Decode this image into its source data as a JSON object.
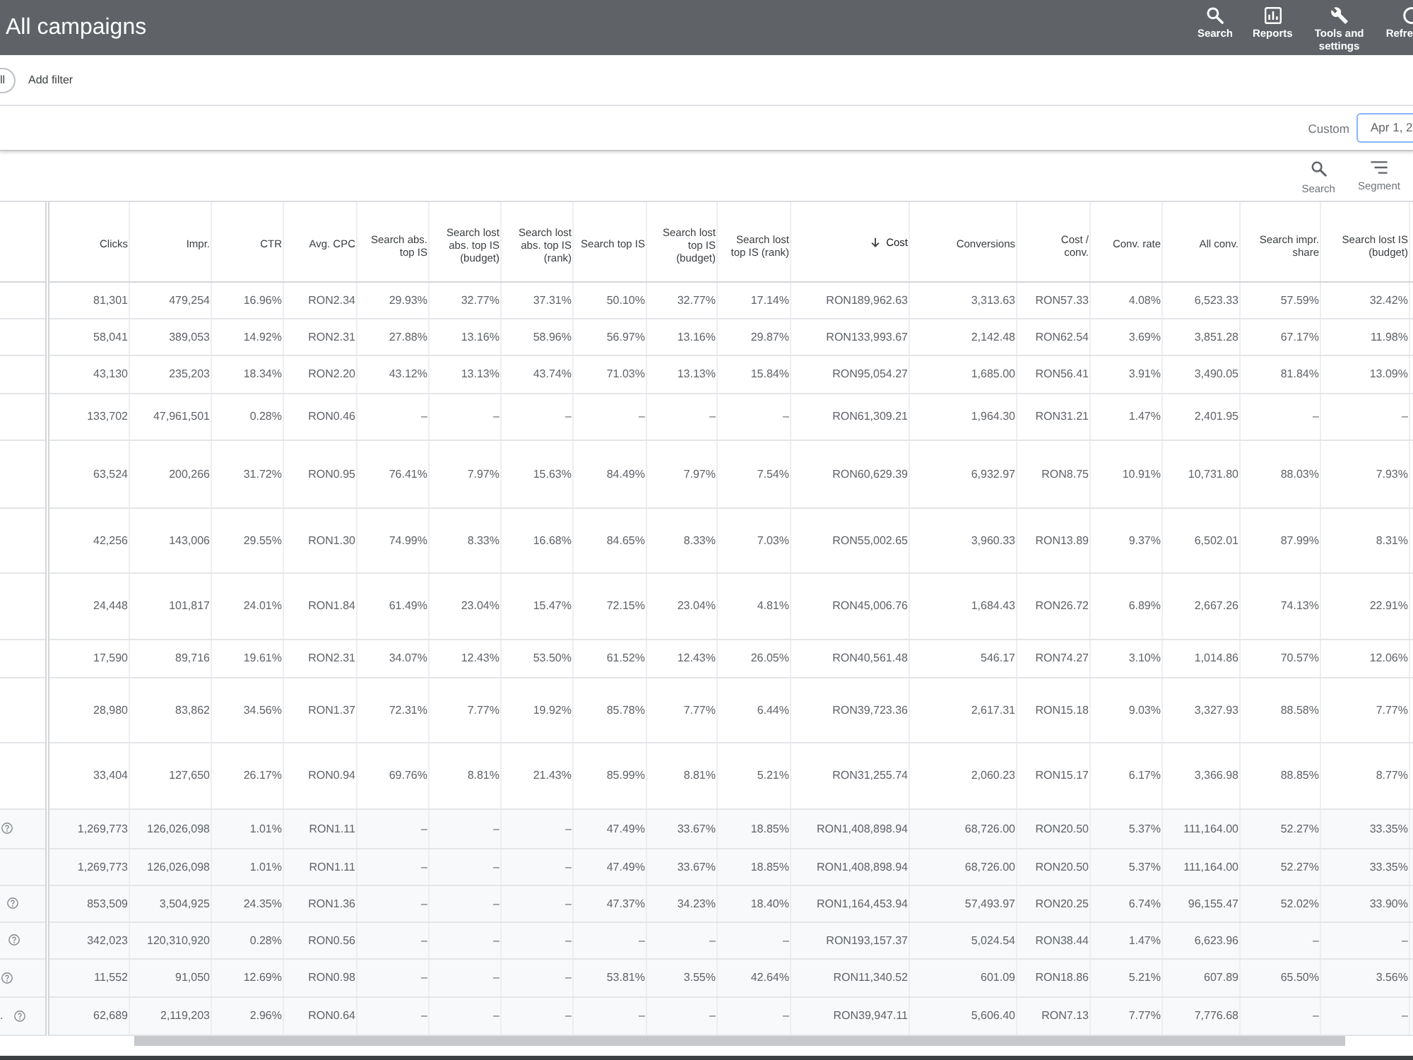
{
  "top_bar": {
    "title": "All campaigns",
    "actions": [
      {
        "kind": "search",
        "label": "Search"
      },
      {
        "kind": "reports",
        "label": "Reports"
      },
      {
        "kind": "tools",
        "label": "Tools and settings"
      },
      {
        "kind": "refresh",
        "label": "Refre"
      }
    ]
  },
  "filter_bar": {
    "chip": "ll",
    "add_filter": "Add filter"
  },
  "date_bar": {
    "range_label": "Custom",
    "date_field": {
      "value": "Apr 1, 2"
    }
  },
  "toolbar": [
    {
      "kind": "search",
      "label": "Search"
    },
    {
      "kind": "segment",
      "label": "Segment"
    }
  ],
  "table": {
    "columns": [
      {
        "label": "Clicks",
        "sorted": false
      },
      {
        "label": "Impr.",
        "sorted": false
      },
      {
        "label": "CTR",
        "sorted": false
      },
      {
        "label": "Avg. CPC",
        "sorted": false
      },
      {
        "label": "Search abs. top IS",
        "sorted": false
      },
      {
        "label": "Search lost abs. top IS (budget)",
        "sorted": false
      },
      {
        "label": "Search lost abs. top IS (rank)",
        "sorted": false
      },
      {
        "label": "Search top IS",
        "sorted": false
      },
      {
        "label": "Search lost top IS (budget)",
        "sorted": false
      },
      {
        "label": "Search lost top IS (rank)",
        "sorted": false
      },
      {
        "label": "Cost",
        "sorted": true
      },
      {
        "label": "Conversions",
        "sorted": false
      },
      {
        "label": "Cost / conv.",
        "sorted": false
      },
      {
        "label": "Conv. rate",
        "sorted": false
      },
      {
        "label": "All conv.",
        "sorted": false
      },
      {
        "label": "Search impr. share",
        "sorted": false
      },
      {
        "label": "Search lost IS (budget)",
        "sorted": false
      }
    ],
    "rows": [
      {
        "cells": [
          "81,301",
          "479,254",
          "16.96%",
          "RON2.34",
          "29.93%",
          "32.77%",
          "37.31%",
          "50.10%",
          "32.77%",
          "17.14%",
          "RON189,962.63",
          "3,313.63",
          "RON57.33",
          "4.08%",
          "6,523.33",
          "57.59%",
          "32.42%"
        ]
      },
      {
        "cells": [
          "58,041",
          "389,053",
          "14.92%",
          "RON2.31",
          "27.88%",
          "13.16%",
          "58.96%",
          "56.97%",
          "13.16%",
          "29.87%",
          "RON133,993.67",
          "2,142.48",
          "RON62.54",
          "3.69%",
          "3,851.28",
          "67.17%",
          "11.98%"
        ]
      },
      {
        "cells": [
          "43,130",
          "235,203",
          "18.34%",
          "RON2.20",
          "43.12%",
          "13.13%",
          "43.74%",
          "71.03%",
          "13.13%",
          "15.84%",
          "RON95,054.27",
          "1,685.00",
          "RON56.41",
          "3.91%",
          "3,490.05",
          "81.84%",
          "13.09%"
        ]
      },
      {
        "cells": [
          "133,702",
          "47,961,501",
          "0.28%",
          "RON0.46",
          "–",
          "–",
          "–",
          "–",
          "–",
          "–",
          "RON61,309.21",
          "1,964.30",
          "RON31.21",
          "1.47%",
          "2,401.95",
          "–",
          "–"
        ]
      },
      {
        "cells": [
          "63,524",
          "200,266",
          "31.72%",
          "RON0.95",
          "76.41%",
          "7.97%",
          "15.63%",
          "84.49%",
          "7.97%",
          "7.54%",
          "RON60,629.39",
          "6,932.97",
          "RON8.75",
          "10.91%",
          "10,731.80",
          "88.03%",
          "7.93%"
        ]
      },
      {
        "cells": [
          "42,256",
          "143,006",
          "29.55%",
          "RON1.30",
          "74.99%",
          "8.33%",
          "16.68%",
          "84.65%",
          "8.33%",
          "7.03%",
          "RON55,002.65",
          "3,960.33",
          "RON13.89",
          "9.37%",
          "6,502.01",
          "87.99%",
          "8.31%"
        ]
      },
      {
        "cells": [
          "24,448",
          "101,817",
          "24.01%",
          "RON1.84",
          "61.49%",
          "23.04%",
          "15.47%",
          "72.15%",
          "23.04%",
          "4.81%",
          "RON45,006.76",
          "1,684.43",
          "RON26.72",
          "6.89%",
          "2,667.26",
          "74.13%",
          "22.91%"
        ]
      },
      {
        "cells": [
          "17,590",
          "89,716",
          "19.61%",
          "RON2.31",
          "34.07%",
          "12.43%",
          "53.50%",
          "61.52%",
          "12.43%",
          "26.05%",
          "RON40,561.48",
          "546.17",
          "RON74.27",
          "3.10%",
          "1,014.86",
          "70.57%",
          "12.06%"
        ]
      },
      {
        "cells": [
          "28,980",
          "83,862",
          "34.56%",
          "RON1.37",
          "72.31%",
          "7.77%",
          "19.92%",
          "85.78%",
          "7.77%",
          "6.44%",
          "RON39,723.36",
          "2,617.31",
          "RON15.18",
          "9.03%",
          "3,327.93",
          "88.58%",
          "7.77%"
        ]
      },
      {
        "cells": [
          "33,404",
          "127,650",
          "26.17%",
          "RON0.94",
          "69.76%",
          "8.81%",
          "21.43%",
          "85.99%",
          "8.81%",
          "5.21%",
          "RON31,255.74",
          "2,060.23",
          "RON15.17",
          "6.17%",
          "3,366.98",
          "88.85%",
          "8.77%"
        ]
      }
    ],
    "summary_rows": [
      {
        "help": true,
        "cells": [
          "1,269,773",
          "126,026,098",
          "1.01%",
          "RON1.11",
          "–",
          "–",
          "–",
          "47.49%",
          "33.67%",
          "18.85%",
          "RON1,408,898.94",
          "68,726.00",
          "RON20.50",
          "5.37%",
          "111,164.00",
          "52.27%",
          "33.35%"
        ]
      },
      {
        "help": false,
        "cells": [
          "1,269,773",
          "126,026,098",
          "1.01%",
          "RON1.11",
          "–",
          "–",
          "–",
          "47.49%",
          "33.67%",
          "18.85%",
          "RON1,408,898.94",
          "68,726.00",
          "RON20.50",
          "5.37%",
          "111,164.00",
          "52.27%",
          "33.35%"
        ]
      },
      {
        "help": true,
        "cells": [
          "853,509",
          "3,504,925",
          "24.35%",
          "RON1.36",
          "–",
          "–",
          "–",
          "47.37%",
          "34.23%",
          "18.40%",
          "RON1,164,453.94",
          "57,493.97",
          "RON20.25",
          "6.74%",
          "96,155.47",
          "52.02%",
          "33.90%"
        ]
      },
      {
        "help": true,
        "cells": [
          "342,023",
          "120,310,920",
          "0.28%",
          "RON0.56",
          "–",
          "–",
          "–",
          "–",
          "–",
          "–",
          "RON193,157.37",
          "5,024.54",
          "RON38.44",
          "1.47%",
          "6,623.96",
          "–",
          "–"
        ]
      },
      {
        "help": true,
        "cells": [
          "11,552",
          "91,050",
          "12.69%",
          "RON0.98",
          "–",
          "–",
          "–",
          "53.81%",
          "3.55%",
          "42.64%",
          "RON11,340.52",
          "601.09",
          "RON18.86",
          "5.21%",
          "607.89",
          "65.50%",
          "3.56%"
        ]
      },
      {
        "label": ".",
        "help": true,
        "cells": [
          "62,689",
          "2,119,203",
          "2.96%",
          "RON0.64",
          "–",
          "–",
          "–",
          "–",
          "–",
          "–",
          "RON39,947.11",
          "5,606.40",
          "RON7.13",
          "7.77%",
          "7,776.68",
          "–",
          "–"
        ]
      }
    ]
  }
}
